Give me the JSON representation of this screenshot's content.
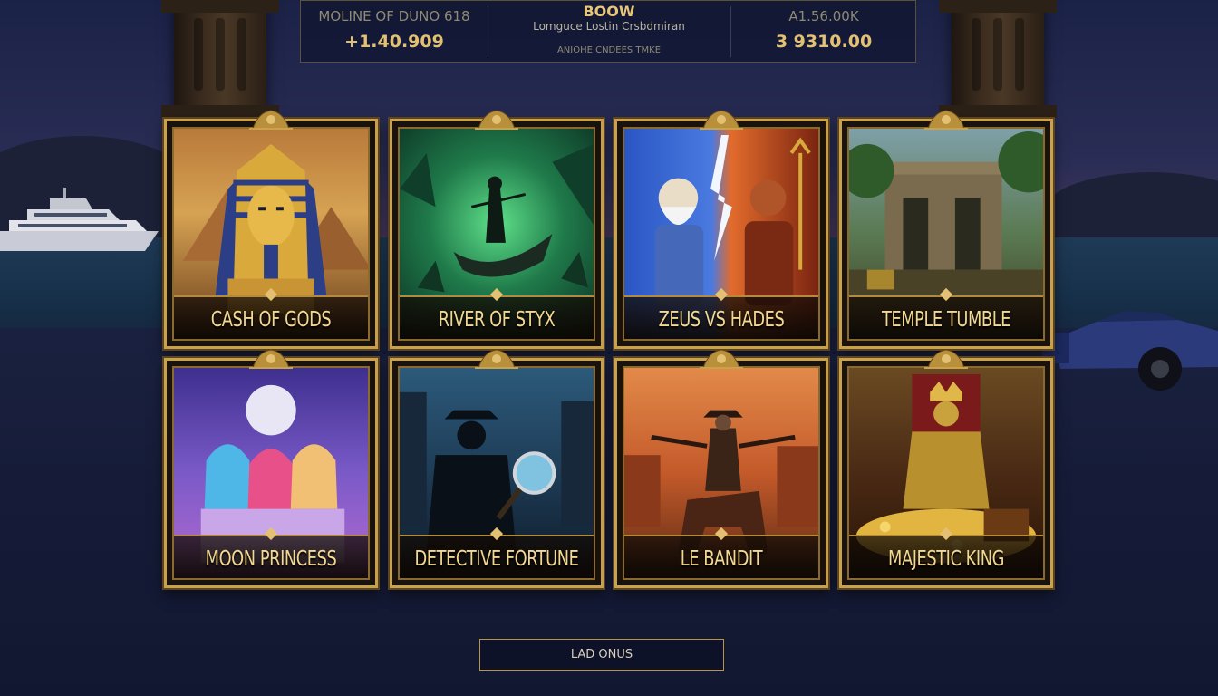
{
  "stats": {
    "left": {
      "label": "MOLINE OF DUNO 618",
      "value": "+1.40.909"
    },
    "center": {
      "title": "BOOW",
      "subtitle": "Lomguce Lostin Crsbdmiran",
      "small": "ANIOHE CNDEES TMKE"
    },
    "right": {
      "label": "A1.56.00K",
      "value": "3 9310.00"
    }
  },
  "games": [
    {
      "title": "CASH OF GODS",
      "art": "pharaoh"
    },
    {
      "title": "RIVER OF STYX",
      "art": "ferryman"
    },
    {
      "title": "ZEUS VS HADES",
      "art": "gods"
    },
    {
      "title": "TEMPLE TUMBLE",
      "art": "ruins"
    },
    {
      "title": "MOON PRINCESS",
      "art": "princesses"
    },
    {
      "title": "DETECTIVE FORTUNE",
      "art": "detective"
    },
    {
      "title": "LE BANDIT",
      "art": "bandit"
    },
    {
      "title": "MAJESTIC KING",
      "art": "king"
    }
  ],
  "load_button": {
    "label": "LAD ONUS"
  },
  "colors": {
    "gold": "#caa24c",
    "label_gold": "#f3d891",
    "night": "#141a33"
  }
}
